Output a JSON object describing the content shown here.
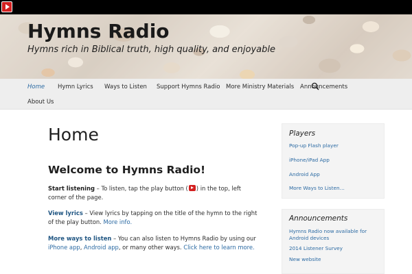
{
  "site": {
    "title": "Hymns Radio",
    "tagline": "Hymns rich in Biblical truth, high quality, and enjoyable"
  },
  "player": {
    "icon": "play-icon",
    "color": "#d32020"
  },
  "nav": {
    "items": [
      {
        "label": "Home",
        "active": true
      },
      {
        "label": "Hymn Lyrics"
      },
      {
        "label": "Ways to Listen"
      },
      {
        "label": "Support Hymns Radio"
      },
      {
        "label": "More Ministry Materials"
      },
      {
        "label": "Announcements"
      },
      {
        "label": "About Us"
      }
    ],
    "search_icon": "search-icon"
  },
  "main": {
    "page_title": "Home",
    "heading": "Welcome to Hymns Radio!",
    "p1": {
      "label": "Start listening",
      "text_a": " – To listen, tap the play button (",
      "text_b": ") in the top, left corner of the page."
    },
    "p2": {
      "label": "View lyrics",
      "text": " – View lyrics by tapping on the title of the hymn to the right of the play button. ",
      "link": "More info."
    },
    "p3": {
      "label": "More ways to listen",
      "text_a": " – You can also listen to Hymns Radio by using our ",
      "link1": "iPhone app",
      "sep": ", ",
      "link2": "Android app",
      "text_b": ", or many other ways. ",
      "link3": "Click here to learn more."
    }
  },
  "sidebar": {
    "players": {
      "title": "Players",
      "links": [
        "Pop-up Flash player",
        "iPhone/iPad App",
        "Android App",
        "More Ways to Listen…"
      ]
    },
    "announcements": {
      "title": "Announcements",
      "links": [
        "Hymns Radio now available for Android devices",
        "2014 Listener Survey",
        "New website"
      ]
    }
  },
  "colors": {
    "link": "#2b6aa3",
    "nav_bg": "#eeeeee",
    "topbar": "#000000",
    "widget_bg": "#f4f4f4"
  }
}
